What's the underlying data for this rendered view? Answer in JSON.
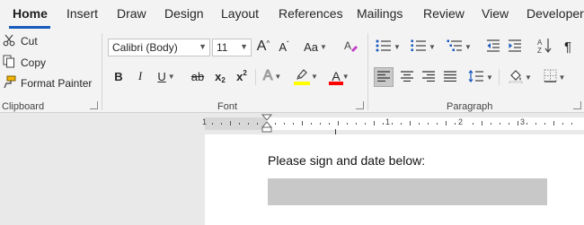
{
  "tabs": [
    "Home",
    "Insert",
    "Draw",
    "Design",
    "Layout",
    "References",
    "Mailings",
    "Review",
    "View",
    "Developer"
  ],
  "clipboard": {
    "cut": "Cut",
    "copy": "Copy",
    "format_painter": "Format Painter",
    "label": "Clipboard"
  },
  "font": {
    "family": "Calibri (Body)",
    "size": "11",
    "grow": "A",
    "shrink": "A",
    "case": "Aa",
    "bold": "B",
    "italic": "I",
    "underline": "U",
    "strikethrough": "ab",
    "subscript_base": "x",
    "subscript_mark": "2",
    "superscript_base": "x",
    "superscript_mark": "2",
    "text_effects": "A",
    "font_color": "A",
    "label": "Font",
    "highlight_color": "#ffff00",
    "font_color_value": "#ff0000"
  },
  "paragraph": {
    "label": "Paragraph"
  },
  "ruler": {
    "numbers": [
      "1",
      "1",
      "2",
      "3"
    ]
  },
  "document": {
    "text": "Please sign and date below:"
  },
  "colors": {
    "accent": "#185abd"
  }
}
